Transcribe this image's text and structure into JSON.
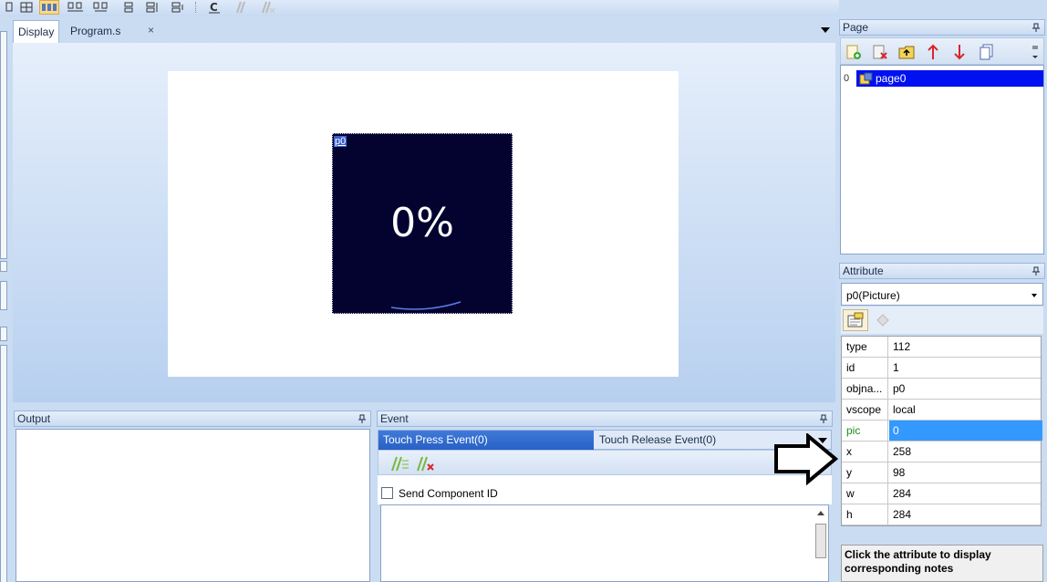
{
  "document_tabs": [
    {
      "label": "Display",
      "active": true
    },
    {
      "label": "Program.s",
      "active": false
    }
  ],
  "document_tab_close": "×",
  "canvas": {
    "picture": {
      "label": "p0",
      "text": "0%"
    }
  },
  "output_panel": {
    "title": "Output"
  },
  "event_panel": {
    "title": "Event",
    "tabs": [
      {
        "label": "Touch Press Event(0)",
        "active": true
      },
      {
        "label": "Touch Release Event(0)",
        "active": false
      }
    ],
    "send_component_id_label": "Send Component ID",
    "send_component_id_checked": false
  },
  "page_panel": {
    "title": "Page",
    "toolbar_icons": [
      "add-page-icon",
      "delete-page-icon",
      "insert-page-icon",
      "move-up-icon",
      "move-down-icon",
      "copy-page-icon"
    ],
    "pages": [
      {
        "index": "0",
        "name": "page0",
        "selected": true
      }
    ]
  },
  "attribute_panel": {
    "title": "Attribute",
    "selected_component": "p0(Picture)",
    "rows": [
      {
        "key": "type",
        "value": "112"
      },
      {
        "key": "id",
        "value": "1"
      },
      {
        "key": "objna...",
        "value": "p0"
      },
      {
        "key": "vscope",
        "value": "local"
      },
      {
        "key": "pic",
        "value": "0",
        "selected": true
      },
      {
        "key": "x",
        "value": "258"
      },
      {
        "key": "y",
        "value": "98"
      },
      {
        "key": "w",
        "value": "284"
      },
      {
        "key": "h",
        "value": "284"
      }
    ],
    "note": "Click the attribute to display corresponding notes"
  },
  "colors": {
    "picture_background": "#040330",
    "selection_blue": "#3399ff",
    "page_selection": "#0010f0",
    "event_tab_active": "#2f6ccf"
  }
}
